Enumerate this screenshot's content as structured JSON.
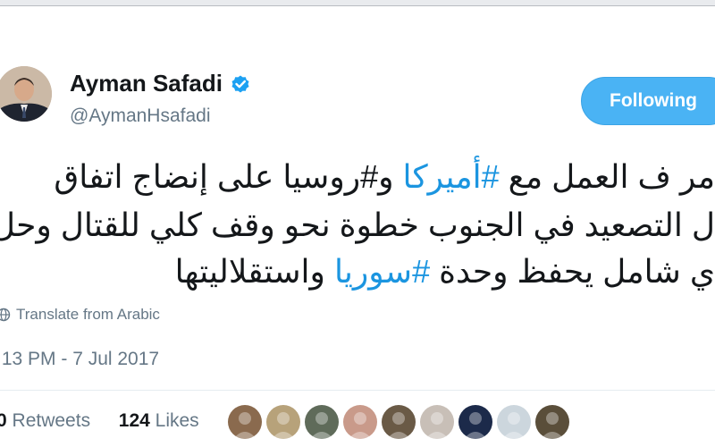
{
  "profile": {
    "name": "Ayman Safadi",
    "handle": "@AymanHsafadi",
    "verified_icon": "verified-badge-icon",
    "follow_label": "Following"
  },
  "tweet": {
    "line1": {
      "pre": "مر ف العمل مع ",
      "tag": "#أميركا",
      "post": " و#روسيا على إنضاج اتفاق"
    },
    "line2": "ل التصعيد في الجنوب خطوة نحو وقف كلي للقتال وحل",
    "line3": {
      "pre": "ي شامل يحفظ وحدة ",
      "tag": "#سوريا",
      "post": " واستقلاليتها"
    }
  },
  "translate_label": "Translate from Arabic",
  "timestamp": ":13 PM - 7 Jul 2017",
  "stats": {
    "retweets_count": "0",
    "retweets_label": "Retweets",
    "likes_count": "124",
    "likes_label": "Likes"
  },
  "likers": [
    {
      "name": "liker-avatar-1",
      "color": "#8a6a4e"
    },
    {
      "name": "liker-avatar-2",
      "color": "#b7a27a"
    },
    {
      "name": "liker-avatar-3",
      "color": "#5f6b5a"
    },
    {
      "name": "liker-avatar-4",
      "color": "#c99a8a"
    },
    {
      "name": "liker-avatar-5",
      "color": "#6a5a46"
    },
    {
      "name": "liker-avatar-6",
      "color": "#c8bfb7"
    },
    {
      "name": "liker-avatar-7",
      "color": "#1c2a4a"
    },
    {
      "name": "liker-avatar-8",
      "color": "#ccd6dd"
    },
    {
      "name": "liker-avatar-9",
      "color": "#5a4e3a"
    }
  ],
  "colors": {
    "accent": "#1b95e0",
    "follow_bg": "#4ab3f4",
    "muted": "#657786"
  }
}
